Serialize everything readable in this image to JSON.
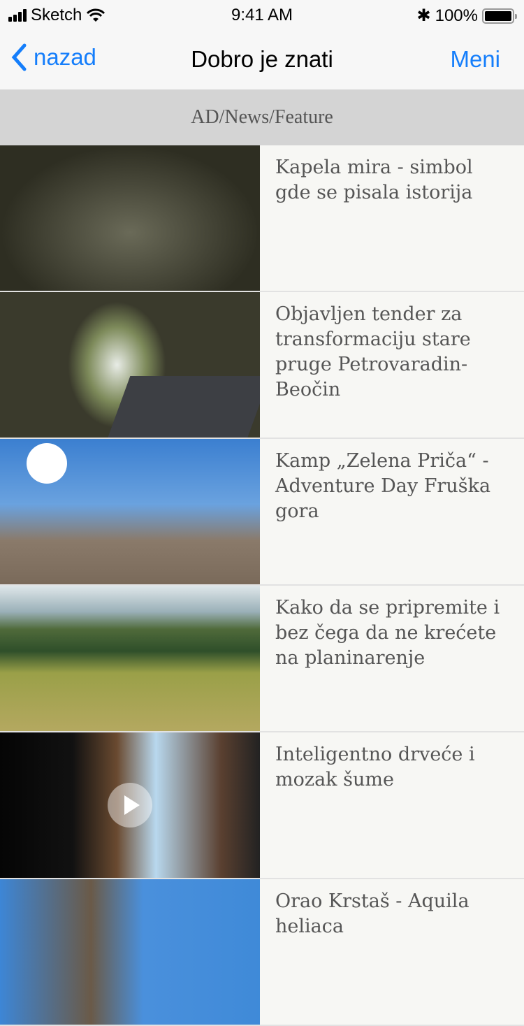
{
  "status": {
    "carrier": "Sketch",
    "time": "9:41 AM",
    "battery": "100%"
  },
  "nav": {
    "back": "nazad",
    "title": "Dobro je znati",
    "menu": "Meni"
  },
  "section": "AD/News/Feature",
  "articles": [
    {
      "title": "Kapela mira - simbol gde se pisala istorija"
    },
    {
      "title": "Objavljen tender za transformaciju stare pruge Petrovaradin-Beočin"
    },
    {
      "title": "Kamp „Zelena Priča“ - Adventure Day Fruška gora"
    },
    {
      "title": "Kako da se pripremite i bez čega da ne krećete na planinarenje"
    },
    {
      "title": "Inteligentno drveće i mozak šume"
    },
    {
      "title": "Orao Krstaš - Aquila heliaca"
    }
  ]
}
